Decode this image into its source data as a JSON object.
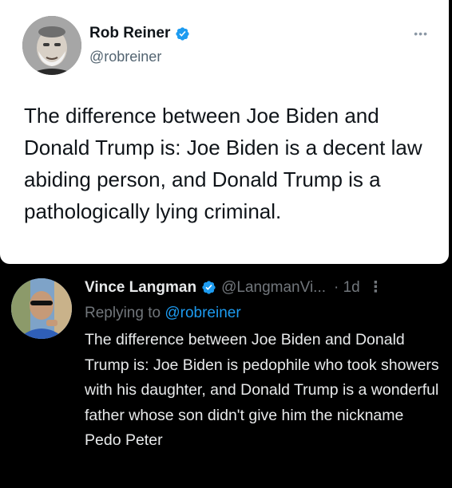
{
  "original_tweet": {
    "author_name": "Rob Reiner",
    "author_handle": "@robreiner",
    "more_icon": "ellipsis-icon",
    "verified_icon": "verified-badge-icon",
    "text": "The difference between Joe Biden and Donald Trump is: Joe Biden is a decent law abiding person, and Donald Trump is a pathologically lying criminal."
  },
  "reply_tweet": {
    "author_name": "Vince Langman",
    "author_handle": "@LangmanVi...",
    "time": "· 1d",
    "more_icon": "vertical-ellipsis-icon",
    "verified_icon": "verified-badge-icon",
    "replying_prefix": "Replying to",
    "replying_to": "@robreiner",
    "text": "The difference between Joe Biden and Donald Trump is:  Joe Biden is pedophile who took showers with his daughter, and Donald Trump is a wonderful father whose son didn't give him the nickname Pedo Peter"
  },
  "colors": {
    "verified_blue": "#1d9bf0",
    "dark_bg": "#000000",
    "light_bg": "#ffffff",
    "muted_text": "#71767b"
  }
}
